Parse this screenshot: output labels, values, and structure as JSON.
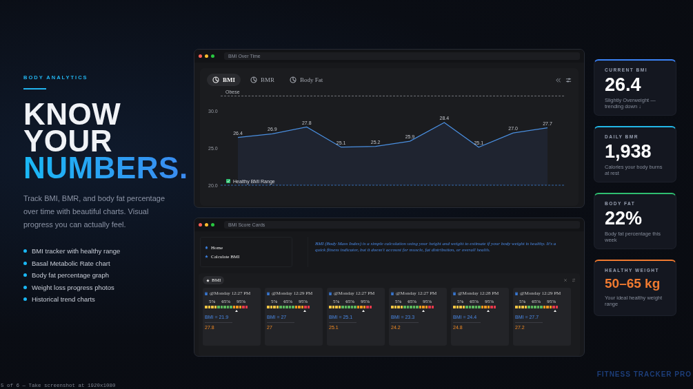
{
  "eyebrow": "BODY ANALYTICS",
  "headline": [
    {
      "text": "KNOW",
      "kind": "plain"
    },
    {
      "text": "YOUR",
      "kind": "plain"
    },
    {
      "text": "NUMBERS.",
      "kind": "accent"
    }
  ],
  "intro": "Track BMI, BMR, and body fat percentage over time with beautiful charts. Visual progress you can actually feel.",
  "features": [
    "BMI tracker with healthy range",
    "Basal Metabolic Rate chart",
    "Body fat percentage graph",
    "Weight loss progress photos",
    "Historical trend charts"
  ],
  "chart_window": {
    "title": "BMI Over Time",
    "tabs": [
      {
        "label": "BMI",
        "selected": true
      },
      {
        "label": "BMR",
        "selected": false
      },
      {
        "label": "Body Fat",
        "selected": false
      }
    ],
    "obese_label": "Obese",
    "healthy_label": "Healthy BMI Range",
    "chart_data": {
      "type": "area",
      "ylim": [
        20,
        32
      ],
      "yticks": [
        {
          "value": 20,
          "label": "20.0"
        },
        {
          "value": 25,
          "label": "25.0"
        },
        {
          "value": 30,
          "label": "30.0"
        }
      ],
      "value_labels": [
        "26.4",
        "26.9",
        "27.8",
        "25.1",
        "25.2",
        "25.9",
        "28.4",
        "25.1",
        "27.0",
        "27.7"
      ],
      "series": [
        {
          "color": "#4a8fe0",
          "values": [
            26.4,
            26.9,
            27.8,
            25.1,
            25.2,
            25.9,
            28.4,
            25.1,
            27.0,
            27.7
          ]
        }
      ]
    }
  },
  "cards_window": {
    "title": "BMI Score Cards",
    "nav": [
      {
        "label": "Home",
        "kind": "home"
      },
      {
        "label": "Calculate BMI",
        "kind": "star"
      }
    ],
    "description": "BMI (Body Mass Index) is a simple calculation using your height and weight to estimate if your body weight is healthy. It's a quick fitness indicator, but it doesn't account for muscle, fat distribution, or overall health.",
    "section_chip": "BMI",
    "cards": [
      {
        "time": "@Monday 12:27 PM",
        "ticks": [
          "5%",
          "65%",
          "95%"
        ],
        "level": 0.72,
        "bmi": "BMI = 21.9",
        "value": "27.8"
      },
      {
        "time": "@Monday 12:29 PM",
        "ticks": [
          "5%",
          "65%",
          "95%"
        ],
        "level": 0.86,
        "bmi": "BMI = 27",
        "value": "27"
      },
      {
        "time": "@Monday 12:27 PM",
        "ticks": [
          "5%",
          "65%",
          "95%"
        ],
        "level": 0.78,
        "bmi": "BMI = 25.1",
        "value": "25.1"
      },
      {
        "time": "@Monday 12:27 PM",
        "ticks": [
          "5%",
          "65%",
          "95%"
        ],
        "level": 0.74,
        "bmi": "BMI = 23.3",
        "value": "24.2"
      },
      {
        "time": "@Monday 12:28 PM",
        "ticks": [
          "5%",
          "65%",
          "95%"
        ],
        "level": 0.8,
        "bmi": "BMI = 24.4",
        "value": "24.8"
      },
      {
        "time": "@Monday 12:29 PM",
        "ticks": [
          "5%",
          "65%",
          "95%"
        ],
        "level": 0.9,
        "bmi": "BMI = 27.7",
        "value": "27.2"
      }
    ]
  },
  "stats": [
    {
      "label": "CURRENT BMI",
      "value": "26.4",
      "note": "Slightly Overweight — trending down ↓",
      "color": "#3b82f6",
      "kind": "plain"
    },
    {
      "label": "DAILY BMR",
      "value": "1,938",
      "note": "Calories your body burns at rest",
      "color": "#22b8e8",
      "kind": "plain"
    },
    {
      "label": "BODY FAT",
      "value": "22%",
      "note": "Body fat percentage this week",
      "color": "#2fbf71",
      "kind": "plain"
    },
    {
      "label": "HEALTHY WEIGHT",
      "value": "50–65 kg",
      "note": "Your ideal healthy weight range",
      "color": "#f07a30",
      "kind": "highlight"
    }
  ],
  "brand": "FITNESS TRACKER PRO",
  "caption": "5 of 6 — Take screenshot at 1920x1080"
}
